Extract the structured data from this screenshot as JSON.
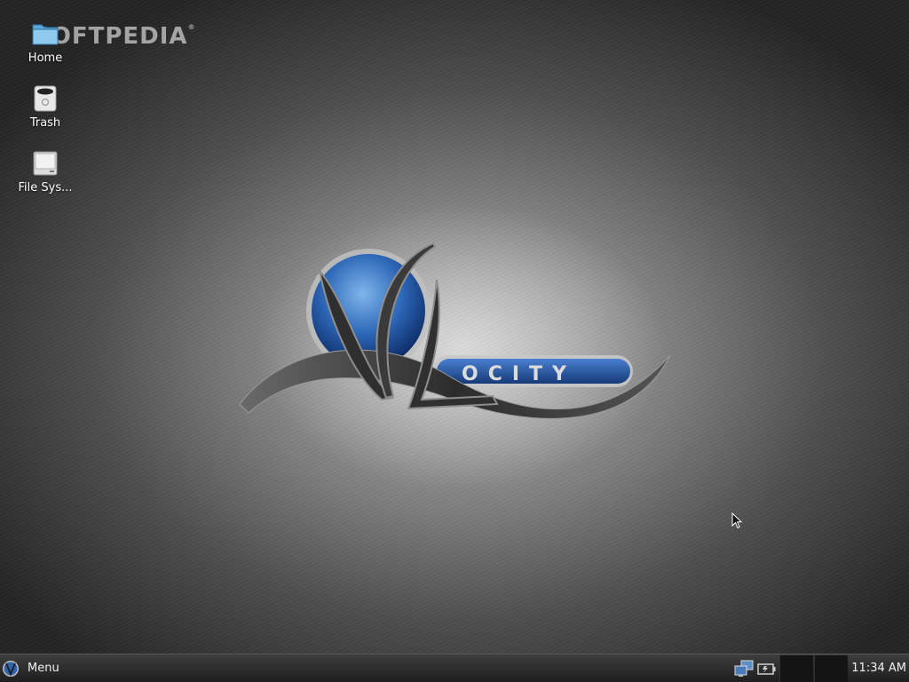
{
  "watermark": {
    "text": "SOFTPEDIA",
    "mark": "®"
  },
  "desktop": {
    "icons": [
      {
        "label": "Home"
      },
      {
        "label": "Trash"
      },
      {
        "label": "File Sys..."
      }
    ],
    "logo": {
      "text": "OCITY"
    }
  },
  "taskbar": {
    "menu_label": "Menu",
    "clock": "11:34 AM"
  }
}
